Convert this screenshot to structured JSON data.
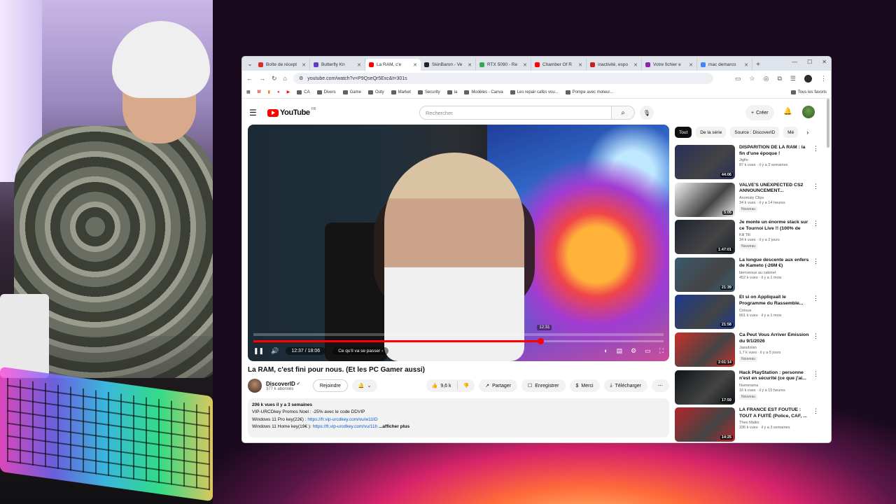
{
  "browser": {
    "tabs": [
      {
        "label": "Boîte de récept",
        "color": "#d93025",
        "active": false
      },
      {
        "label": "Butterfly Kn",
        "color": "#5f3dc4",
        "active": false
      },
      {
        "label": "La RAM, c'e",
        "color": "#ff0000",
        "active": true
      },
      {
        "label": "SkinBaron - Ve",
        "color": "#222222",
        "active": false
      },
      {
        "label": "RTX 5090 - Re",
        "color": "#34a853",
        "active": false
      },
      {
        "label": "Chamber Of R",
        "color": "#ff0000",
        "active": false
      },
      {
        "label": "inactivité, espo",
        "color": "#c5221f",
        "active": false
      },
      {
        "label": "Votre fichier e",
        "color": "#8e24aa",
        "active": false
      },
      {
        "label": "mac demarco",
        "color": "#4285f4",
        "active": false
      }
    ],
    "url": "youtube.com/watch?v=P9QseQr5Exc&t=301s",
    "bookmarks": [
      "CA",
      "Divers",
      "Game",
      "Outy",
      "Market",
      "Security",
      "ia",
      "Modèles - Canva",
      "Les repair cafés vou...",
      "Pompe avec moteur..."
    ],
    "bookmarks_right": "Tous les favoris"
  },
  "youtube": {
    "logo": "YouTube",
    "country": "FR",
    "search_placeholder": "Rechercher",
    "create_label": "Créer"
  },
  "player": {
    "time": "12:37 / 18:06",
    "chapter": "Ce qu'il va se passer",
    "hover_time": "12:31",
    "progress": 0.7
  },
  "video": {
    "title": "La RAM, c'est fini pour nous. (Et les PC Gamer aussi)",
    "channel": "DiscoverID",
    "subscribers": "377 k abonnés",
    "join_label": "Rejoindre",
    "likes": "9,6 k",
    "share_label": "Partager",
    "save_label": "Enregistrer",
    "thanks_label": "Merci",
    "download_label": "Télécharger",
    "description": {
      "meta": "206 k vues  il y a 3 semaines",
      "line1": "VIP-URCDkey Promos Noel : -25% avec le code DDVIP",
      "line2_text": "Windows 11 Pro key(22€) : ",
      "line2_link": "https://fr.vip-urcdkey.com/vu/w11ID",
      "line3_text": "Windows 11 Home key(19€ ): ",
      "line3_link": "https://fr.vip-urcdkey.com/vu/11h",
      "more": "...afficher plus"
    }
  },
  "sidebar": {
    "chips": [
      "Tout",
      "De la série",
      "Source : DiscoverID",
      "Mé"
    ],
    "items": [
      {
        "title": "DISPARITION DE LA RAM : la fin d'une époque !",
        "channel": "Jigfio",
        "meta": "87 k vues · il y a 3 semaines",
        "duration": "44:06",
        "new": "",
        "color": "#2a2f5a"
      },
      {
        "title": "VALVE'S UNEXPECTED CS2 ANNOUNCEMENT...",
        "channel": "Anomaly Clips",
        "meta": "34 k vues · il y a 14 heures",
        "duration": "5:05",
        "new": "Nouveau",
        "color": "#f1f1f1"
      },
      {
        "title": "Je monte un énorme stack sur ce Tournoi Live !! (100% de me...",
        "channel": "Kill Tilt",
        "meta": "34 k vues · il y a 2 jours",
        "duration": "1:47:01",
        "new": "Nouveau",
        "color": "#1d2430"
      },
      {
        "title": "La longue descente aux enfers de Kameto (-26M €)",
        "channel": "bienvenue au cabinet",
        "meta": "452 k vues · il y a 1 mois",
        "duration": "21:39",
        "new": "",
        "color": "#3a5b6e"
      },
      {
        "title": "Et si on Appliquait le Programme du Rassemble...",
        "channel": "Crésus",
        "meta": "661 k vues · il y a 1 mois",
        "duration": "21:58",
        "new": "",
        "color": "#1b3a8f"
      },
      {
        "title": "Ca Peut Vous Arriver Émission du 9/1/2026",
        "channel": "Jassdolan",
        "meta": "1,7 k vues · il y a 5 jours",
        "duration": "2:01:14",
        "new": "Nouveau",
        "color": "#c9302c"
      },
      {
        "title": "Hack PlayStation : personne n'est en sécurité (ce que j'ai...",
        "channel": "Numerama",
        "meta": "16 k vues · il y a 15 heures",
        "duration": "17:59",
        "new": "Nouveau",
        "color": "#101418"
      },
      {
        "title": "LA FRANCE EST FOUTUE : TOUT A FUITÉ (Police, CAF, ...",
        "channel": "Theo Malini",
        "meta": "336 k vues · il y a 3 semaines",
        "duration": "14:25",
        "new": "",
        "color": "#b3262c"
      }
    ]
  }
}
